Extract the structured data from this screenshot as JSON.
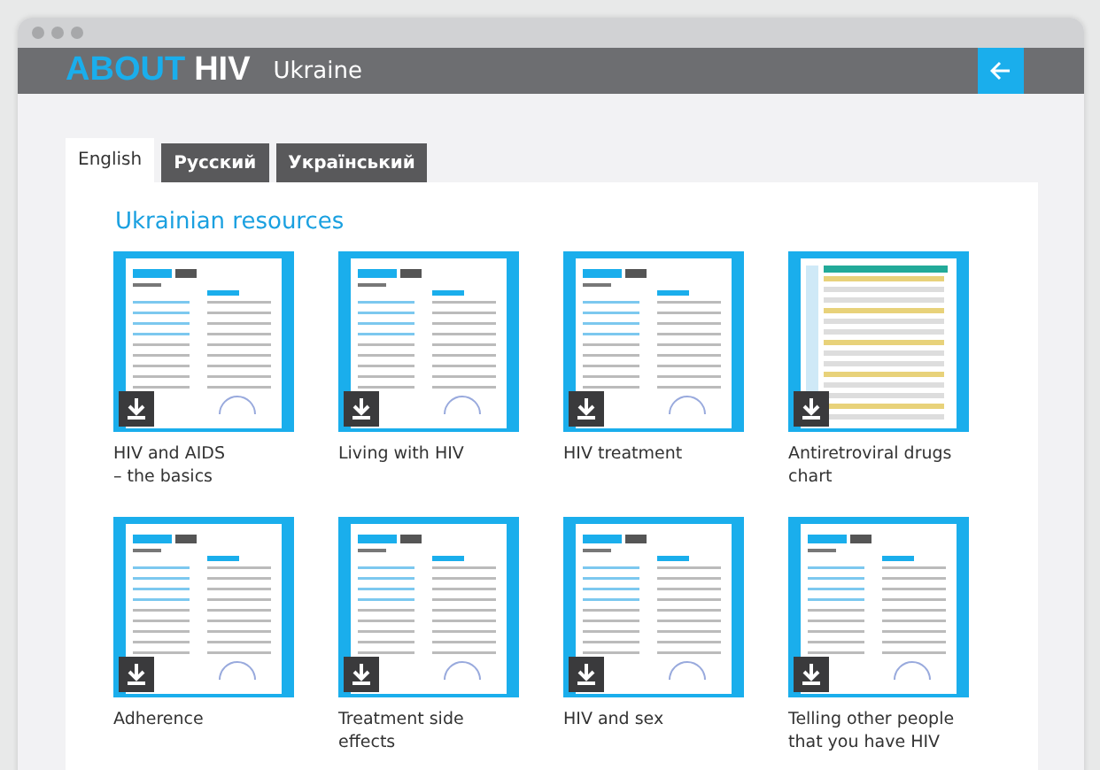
{
  "header": {
    "logo_part_1": "ABOUT",
    "logo_part_2": "HIV",
    "country": "Ukraine"
  },
  "tabs": [
    {
      "label": "English",
      "selected": true
    },
    {
      "label": "Русский",
      "selected": false
    },
    {
      "label": "Український",
      "selected": false
    }
  ],
  "section_title": "Ukrainian resources",
  "resources": [
    {
      "title": "HIV and AIDS\n– the basics",
      "kind": "leaflet"
    },
    {
      "title": "Living with HIV",
      "kind": "leaflet"
    },
    {
      "title": "HIV treatment",
      "kind": "leaflet"
    },
    {
      "title": "Antiretroviral drugs chart",
      "kind": "chart"
    },
    {
      "title": "Adherence",
      "kind": "leaflet"
    },
    {
      "title": "Treatment side effects",
      "kind": "leaflet"
    },
    {
      "title": "HIV and sex",
      "kind": "leaflet"
    },
    {
      "title": "Telling other people that you have HIV",
      "kind": "leaflet"
    }
  ]
}
